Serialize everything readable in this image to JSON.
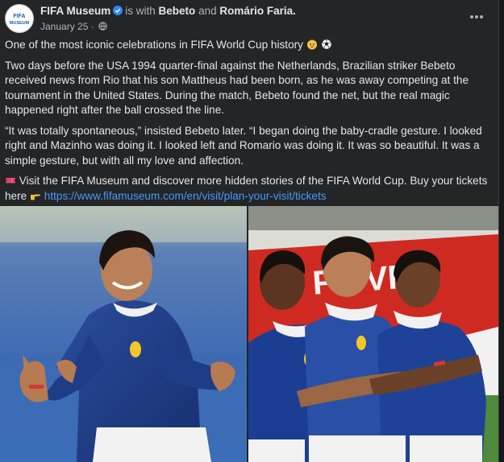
{
  "post": {
    "page_name": "FIFA Museum",
    "with_text": "is with",
    "tagged_1": "Bebeto",
    "and_text": "and",
    "tagged_2": "Romário Faria.",
    "date": "January 25",
    "paragraphs": [
      "One of the most iconic celebrations in FIFA World Cup history",
      "Two days before the USA 1994 quarter-final against the Netherlands, Brazilian striker Bebeto received news from Rio that his son Mattheus had been born, as he was away competing at the tournament in the United States. During the match, Bebeto found the net, but the real magic happened right after the ball crossed the line.",
      "“It was totally spontaneous,” insisted Bebeto later. “I began doing the baby-cradle gesture. I looked right and Mazinho was doing it. I looked left and Romario was doing it. It was so beautiful. It was a simple gesture, but with all my love and affection.",
      "Visit the FIFA Museum and discover more hidden stories of the FIFA World Cup. Buy your tickets here"
    ],
    "link": "https://www.fifamuseum.com/en/visit/plan-your-visit/tickets"
  },
  "icons": {
    "verified": "verified-badge-icon",
    "globe": "public-globe-icon",
    "more": "more-options-icon",
    "baby_emoji": "baby-emoji",
    "ball_emoji": "soccer-ball-emoji",
    "ticket_emoji": "ticket-emoji",
    "point_emoji": "pointing-hand-emoji"
  },
  "colors": {
    "background": "#242526",
    "link": "#4599ff",
    "muted": "#b0b3b8",
    "verified": "#2d88ff"
  }
}
